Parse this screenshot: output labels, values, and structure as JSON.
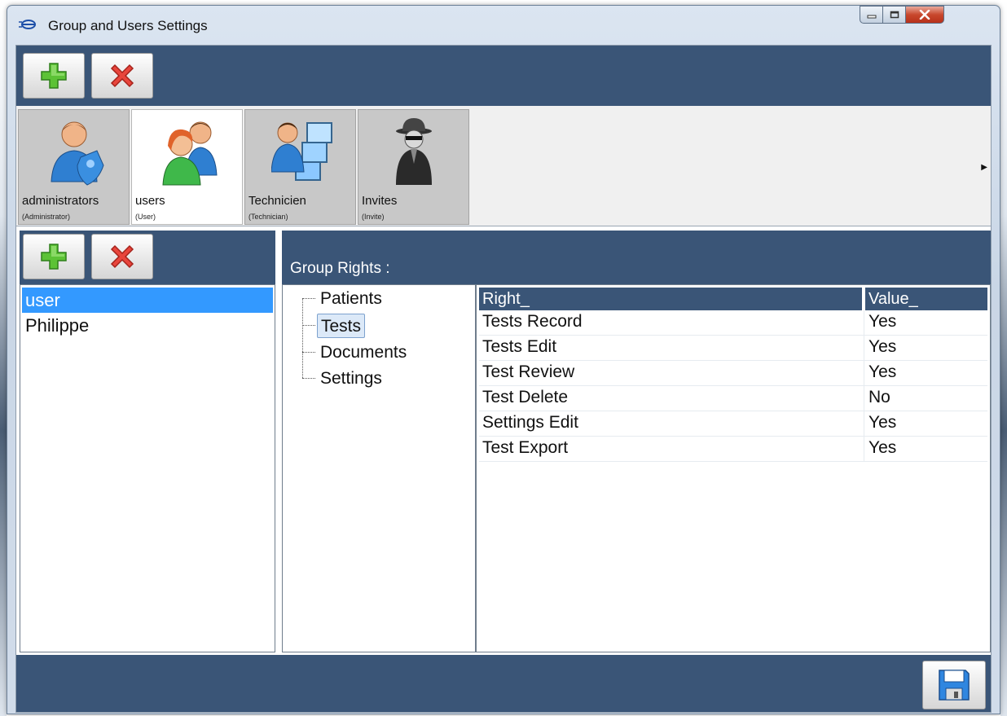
{
  "window": {
    "title": "Group and Users Settings",
    "icon": "app-logo-icon"
  },
  "toolbar": {
    "add_icon": "plus-icon",
    "delete_icon": "delete-x-icon"
  },
  "groups": [
    {
      "name": "administrators",
      "role": "(Administrator)",
      "icon": "admin-user-icon",
      "active": false
    },
    {
      "name": "users",
      "role": "(User)",
      "icon": "users-icon",
      "active": true
    },
    {
      "name": "Technicien",
      "role": "(Technician)",
      "icon": "technician-computers-icon",
      "active": false
    },
    {
      "name": "Invites",
      "role": "(Invite)",
      "icon": "guest-spy-icon",
      "active": false
    }
  ],
  "users": [
    {
      "name": "user",
      "selected": true
    },
    {
      "name": "Philippe",
      "selected": false
    }
  ],
  "rights": {
    "title": "Group Rights :",
    "tree": [
      {
        "label": "Patients",
        "selected": false
      },
      {
        "label": "Tests",
        "selected": true
      },
      {
        "label": "Documents",
        "selected": false
      },
      {
        "label": "Settings",
        "selected": false
      }
    ],
    "columns": {
      "right": "Right_",
      "value": "Value_"
    },
    "rows": [
      {
        "right": "Tests Record",
        "value": "Yes"
      },
      {
        "right": "Tests Edit",
        "value": "Yes"
      },
      {
        "right": "Test Review",
        "value": "Yes"
      },
      {
        "right": "Test Delete",
        "value": "No"
      },
      {
        "right": "Settings Edit",
        "value": "Yes"
      },
      {
        "right": "Test Export",
        "value": "Yes"
      }
    ]
  },
  "bottom": {
    "save_icon": "floppy-save-icon"
  },
  "colors": {
    "panel_bar": "#3a5577",
    "selection": "#3399ff"
  }
}
